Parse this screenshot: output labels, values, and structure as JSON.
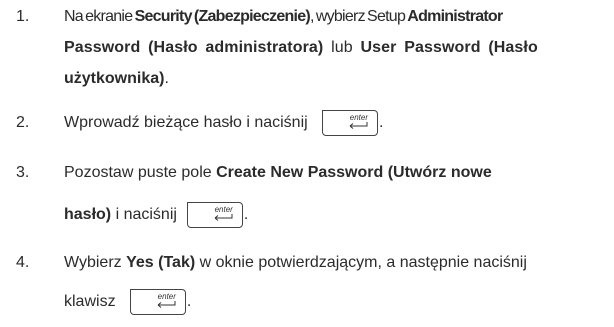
{
  "steps": [
    {
      "number": "1.",
      "line1": {
        "a": "Na ekranie ",
        "b": "Security (Zabezpieczenie)",
        "c": ", wybierz Setup ",
        "d": "Administrator"
      },
      "line2": {
        "a": "Password (Hasło administratora)",
        "b": " lub ",
        "c": "User Password (Hasło"
      },
      "line3": {
        "a": "użytkownika)",
        "b": "."
      }
    },
    {
      "number": "2.",
      "text": "Wprowadź bieżące hasło i naciśnij",
      "after": "."
    },
    {
      "number": "3.",
      "line1": {
        "a": "Pozostaw puste pole ",
        "b": "Create New Password (Utwórz nowe"
      },
      "line2": {
        "a": "hasło)",
        "b": " i naciśnij",
        "after": "."
      }
    },
    {
      "number": "4.",
      "line1": {
        "a": "Wybierz ",
        "b": "Yes (Tak)",
        "c": " w oknie potwierdzającym, a następnie naciśnij"
      },
      "line2": {
        "a": "klawisz",
        "after": "."
      }
    }
  ],
  "key": {
    "label": "enter",
    "icon": "enter-arrow-icon"
  }
}
